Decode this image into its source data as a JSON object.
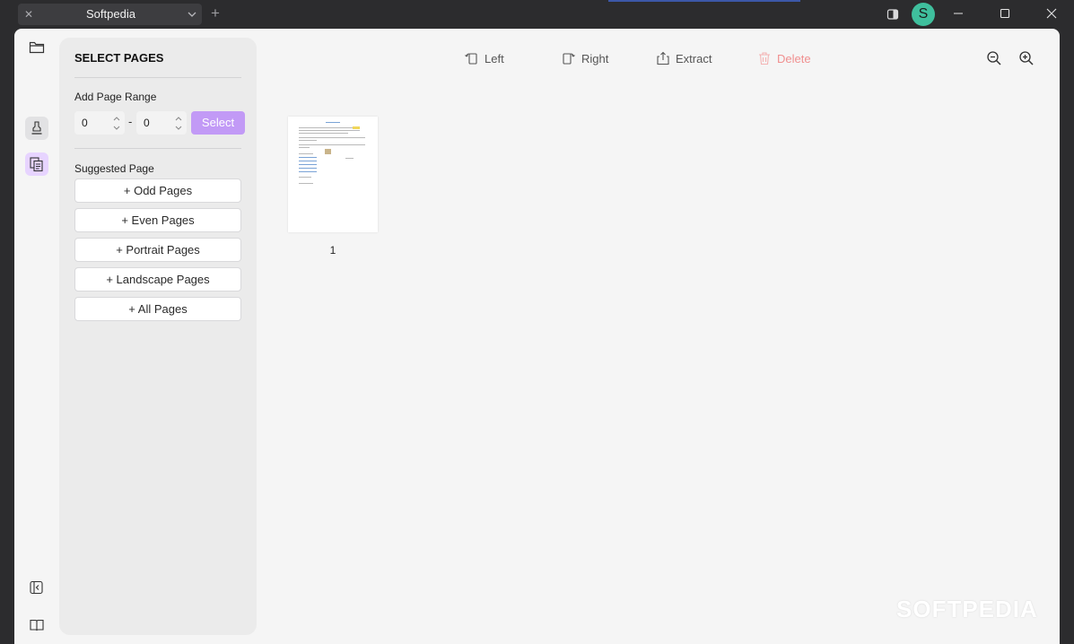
{
  "tab": {
    "title": "Softpedia",
    "close_glyph": "✕",
    "new_glyph": "+"
  },
  "titlebar": {
    "avatar_letter": "S"
  },
  "icons": {
    "tab_close": "close-icon",
    "tab_dropdown": "chevron-down-icon",
    "new_tab": "plus-icon",
    "panel_toggle": "panel-icon",
    "minimize": "minimize-icon",
    "maximize": "maximize-icon",
    "close": "close-icon"
  },
  "rail": {
    "items": [
      "folder-icon",
      "stamp-icon",
      "pages-icon",
      "collapse-panel-icon",
      "book-icon"
    ]
  },
  "panel": {
    "title": "SELECT PAGES",
    "range_label": "Add Page Range",
    "range_from": "0",
    "range_separator": "-",
    "range_to": "0",
    "select_label": "Select",
    "suggested_label": "Suggested Page",
    "suggested": [
      "+ Odd Pages",
      "+ Even Pages",
      "+ Portrait Pages",
      "+ Landscape Pages",
      "+ All Pages"
    ]
  },
  "toolbar": {
    "left_label": "Left",
    "right_label": "Right",
    "extract_label": "Extract",
    "delete_label": "Delete"
  },
  "pages": [
    {
      "number": "1"
    }
  ],
  "watermark": "SOFTPEDIA",
  "colors": {
    "accent": "#c29af6",
    "rail_active": "#e7d4ff",
    "delete": "#f08f8f",
    "avatar": "#3fbf9d",
    "titlebar": "#2c2c2e",
    "background": "#f5f5f5"
  }
}
